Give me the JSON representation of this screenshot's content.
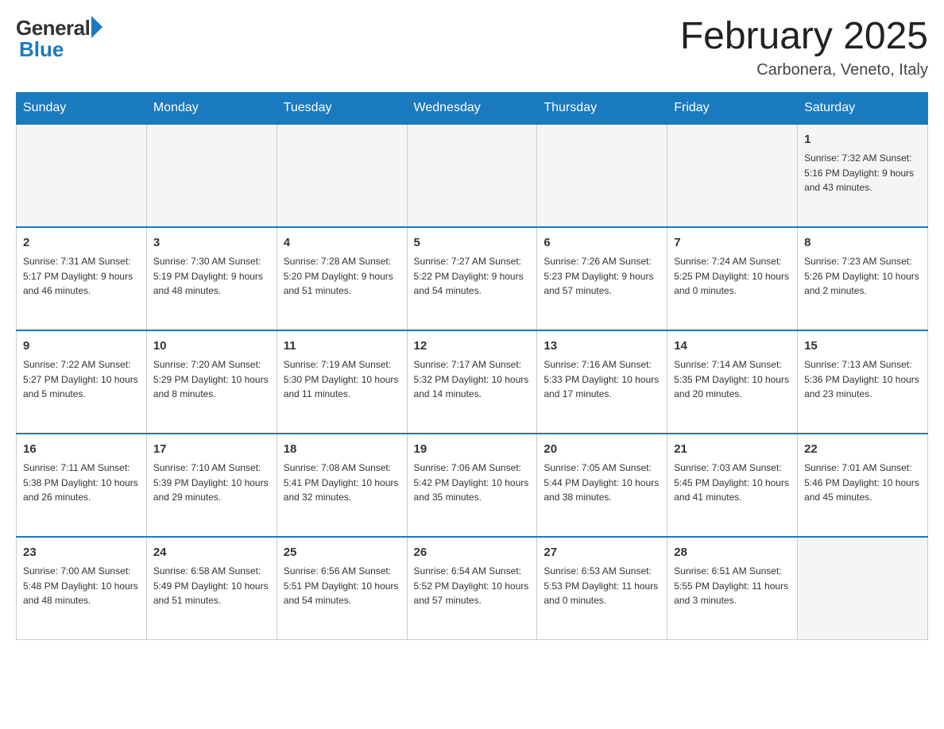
{
  "logo": {
    "general": "General",
    "blue": "Blue"
  },
  "title": "February 2025",
  "location": "Carbonera, Veneto, Italy",
  "days_of_week": [
    "Sunday",
    "Monday",
    "Tuesday",
    "Wednesday",
    "Thursday",
    "Friday",
    "Saturday"
  ],
  "weeks": [
    [
      {
        "day": "",
        "info": ""
      },
      {
        "day": "",
        "info": ""
      },
      {
        "day": "",
        "info": ""
      },
      {
        "day": "",
        "info": ""
      },
      {
        "day": "",
        "info": ""
      },
      {
        "day": "",
        "info": ""
      },
      {
        "day": "1",
        "info": "Sunrise: 7:32 AM\nSunset: 5:16 PM\nDaylight: 9 hours\nand 43 minutes."
      }
    ],
    [
      {
        "day": "2",
        "info": "Sunrise: 7:31 AM\nSunset: 5:17 PM\nDaylight: 9 hours\nand 46 minutes."
      },
      {
        "day": "3",
        "info": "Sunrise: 7:30 AM\nSunset: 5:19 PM\nDaylight: 9 hours\nand 48 minutes."
      },
      {
        "day": "4",
        "info": "Sunrise: 7:28 AM\nSunset: 5:20 PM\nDaylight: 9 hours\nand 51 minutes."
      },
      {
        "day": "5",
        "info": "Sunrise: 7:27 AM\nSunset: 5:22 PM\nDaylight: 9 hours\nand 54 minutes."
      },
      {
        "day": "6",
        "info": "Sunrise: 7:26 AM\nSunset: 5:23 PM\nDaylight: 9 hours\nand 57 minutes."
      },
      {
        "day": "7",
        "info": "Sunrise: 7:24 AM\nSunset: 5:25 PM\nDaylight: 10 hours\nand 0 minutes."
      },
      {
        "day": "8",
        "info": "Sunrise: 7:23 AM\nSunset: 5:26 PM\nDaylight: 10 hours\nand 2 minutes."
      }
    ],
    [
      {
        "day": "9",
        "info": "Sunrise: 7:22 AM\nSunset: 5:27 PM\nDaylight: 10 hours\nand 5 minutes."
      },
      {
        "day": "10",
        "info": "Sunrise: 7:20 AM\nSunset: 5:29 PM\nDaylight: 10 hours\nand 8 minutes."
      },
      {
        "day": "11",
        "info": "Sunrise: 7:19 AM\nSunset: 5:30 PM\nDaylight: 10 hours\nand 11 minutes."
      },
      {
        "day": "12",
        "info": "Sunrise: 7:17 AM\nSunset: 5:32 PM\nDaylight: 10 hours\nand 14 minutes."
      },
      {
        "day": "13",
        "info": "Sunrise: 7:16 AM\nSunset: 5:33 PM\nDaylight: 10 hours\nand 17 minutes."
      },
      {
        "day": "14",
        "info": "Sunrise: 7:14 AM\nSunset: 5:35 PM\nDaylight: 10 hours\nand 20 minutes."
      },
      {
        "day": "15",
        "info": "Sunrise: 7:13 AM\nSunset: 5:36 PM\nDaylight: 10 hours\nand 23 minutes."
      }
    ],
    [
      {
        "day": "16",
        "info": "Sunrise: 7:11 AM\nSunset: 5:38 PM\nDaylight: 10 hours\nand 26 minutes."
      },
      {
        "day": "17",
        "info": "Sunrise: 7:10 AM\nSunset: 5:39 PM\nDaylight: 10 hours\nand 29 minutes."
      },
      {
        "day": "18",
        "info": "Sunrise: 7:08 AM\nSunset: 5:41 PM\nDaylight: 10 hours\nand 32 minutes."
      },
      {
        "day": "19",
        "info": "Sunrise: 7:06 AM\nSunset: 5:42 PM\nDaylight: 10 hours\nand 35 minutes."
      },
      {
        "day": "20",
        "info": "Sunrise: 7:05 AM\nSunset: 5:44 PM\nDaylight: 10 hours\nand 38 minutes."
      },
      {
        "day": "21",
        "info": "Sunrise: 7:03 AM\nSunset: 5:45 PM\nDaylight: 10 hours\nand 41 minutes."
      },
      {
        "day": "22",
        "info": "Sunrise: 7:01 AM\nSunset: 5:46 PM\nDaylight: 10 hours\nand 45 minutes."
      }
    ],
    [
      {
        "day": "23",
        "info": "Sunrise: 7:00 AM\nSunset: 5:48 PM\nDaylight: 10 hours\nand 48 minutes."
      },
      {
        "day": "24",
        "info": "Sunrise: 6:58 AM\nSunset: 5:49 PM\nDaylight: 10 hours\nand 51 minutes."
      },
      {
        "day": "25",
        "info": "Sunrise: 6:56 AM\nSunset: 5:51 PM\nDaylight: 10 hours\nand 54 minutes."
      },
      {
        "day": "26",
        "info": "Sunrise: 6:54 AM\nSunset: 5:52 PM\nDaylight: 10 hours\nand 57 minutes."
      },
      {
        "day": "27",
        "info": "Sunrise: 6:53 AM\nSunset: 5:53 PM\nDaylight: 11 hours\nand 0 minutes."
      },
      {
        "day": "28",
        "info": "Sunrise: 6:51 AM\nSunset: 5:55 PM\nDaylight: 11 hours\nand 3 minutes."
      },
      {
        "day": "",
        "info": ""
      }
    ]
  ]
}
